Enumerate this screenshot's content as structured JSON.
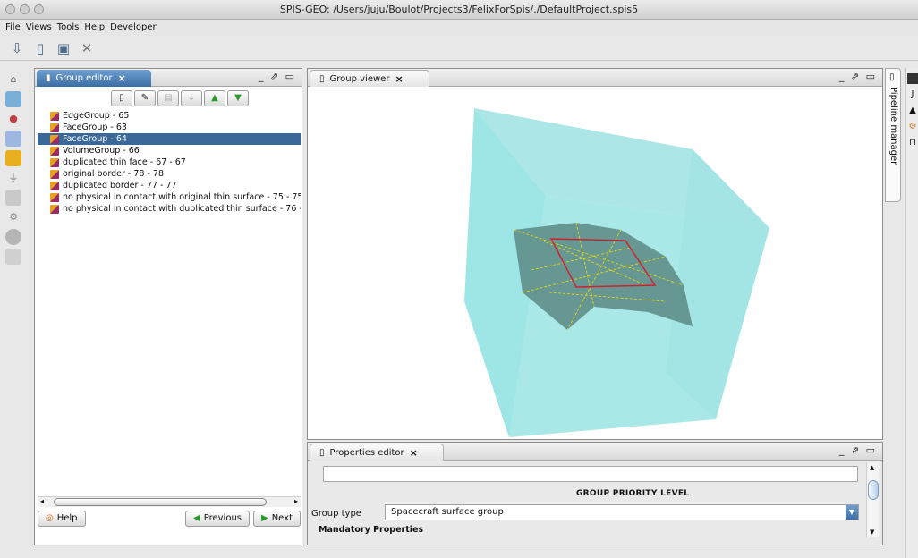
{
  "window": {
    "title": "SPIS-GEO: /Users/juju/Boulot/Projects3/FelixForSpis/./DefaultProject.spis5"
  },
  "menu": {
    "items": [
      "File",
      "Views",
      "Tools",
      "Help",
      "Developer"
    ]
  },
  "toolbar": {
    "icons": [
      "import-icon",
      "open-icon",
      "save-icon",
      "close-icon"
    ]
  },
  "group_editor": {
    "tab_label": "Group editor",
    "tab_close": "×",
    "controls": "_ ⇗ ▭",
    "items": [
      "EdgeGroup - 65",
      "FaceGroup - 63",
      "FaceGroup - 64",
      "VolumeGroup - 66",
      "duplicated thin face - 67 - 67",
      "original border - 78 - 78",
      "duplicated border - 77 - 77",
      "no physical in contact with original thin surface - 75 - 75",
      "no physical in contact with duplicated thin surface - 76 -"
    ],
    "selected_index": 2,
    "help_label": "Help",
    "previous_label": "Previous",
    "next_label": "Next"
  },
  "group_viewer": {
    "tab_label": "Group viewer",
    "tab_close": "×",
    "controls": "_ ⇗ ▭",
    "colors": {
      "box": "#7fd8d8",
      "surface": "#5e8e8a",
      "border": "#cc2233",
      "mesh": "#f0e000"
    }
  },
  "properties_editor": {
    "tab_label": "Properties editor",
    "tab_close": "×",
    "controls": "_ ⇗ ▭",
    "priority_label": "GROUP PRIORITY LEVEL",
    "group_type_label": "Group type",
    "group_type_value": "Spacecraft surface group",
    "mandatory_label": "Mandatory Properties"
  },
  "pipeline": {
    "label": "Pipeline manager"
  }
}
